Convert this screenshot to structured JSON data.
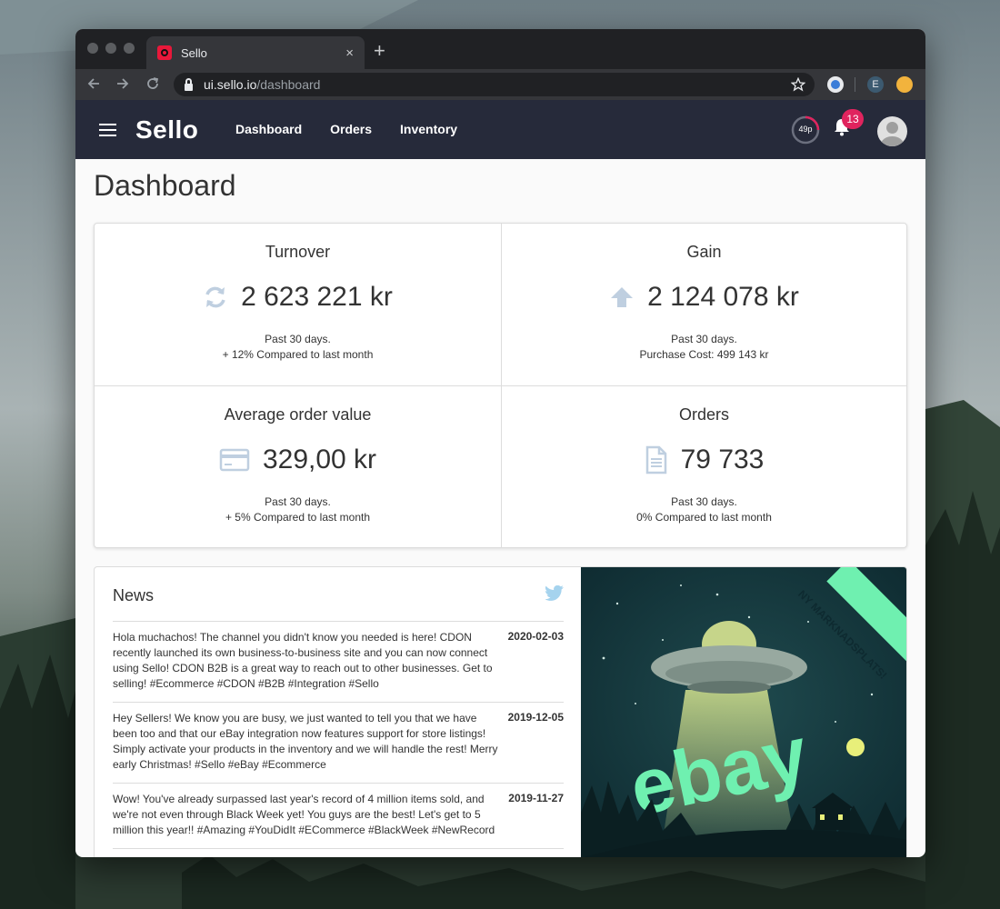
{
  "browser": {
    "tab_title": "Sello",
    "tab_close": "×",
    "new_tab": "+",
    "url_host": "ui.sello.io",
    "url_path": "/dashboard",
    "profile_initial": "E"
  },
  "app": {
    "logo": "Sello",
    "menu": [
      "Dashboard",
      "Orders",
      "Inventory"
    ],
    "quota_label": "49p",
    "notifications_count": "13"
  },
  "page": {
    "title": "Dashboard"
  },
  "stats": [
    {
      "title": "Turnover",
      "value": "2 623 221 kr",
      "icon": "refresh-icon",
      "sub1": "Past 30 days.",
      "sub2": "+ 12% Compared to last month"
    },
    {
      "title": "Gain",
      "value": "2 124 078 kr",
      "icon": "arrow-up-icon",
      "sub1": "Past 30 days.",
      "sub2": "Purchase Cost: 499 143 kr"
    },
    {
      "title": "Average order value",
      "value": "329,00 kr",
      "icon": "credit-card-icon",
      "sub1": "Past 30 days.",
      "sub2": "+ 5% Compared to last month"
    },
    {
      "title": "Orders",
      "value": "79 733",
      "icon": "document-icon",
      "sub1": "Past 30 days.",
      "sub2": "0% Compared to last month"
    }
  ],
  "news": {
    "title": "News",
    "items": [
      {
        "date": "2020-02-03",
        "text": "Hola muchachos! The channel you didn't know you needed is here! CDON recently launched its own business-to-business site and you can now connect using Sello! CDON B2B is a great way to reach out to other businesses. Get to selling! #Ecommerce #CDON #B2B #Integration #Sello"
      },
      {
        "date": "2019-12-05",
        "text": "Hey Sellers! We know you are busy, we just wanted to tell you that we have been too and that our eBay integration now features support for store listings! Simply activate your products in the inventory and we will handle the rest! Merry early Christmas! #Sello #eBay #Ecommerce"
      },
      {
        "date": "2019-11-27",
        "text": "Wow! You've already surpassed last year's record of 4 million items sold, and we're not even through Black Week yet! You guys are the best! Let's get to 5 million this year!! #Amazing #YouDidIt #ECommerce #BlackWeek #NewRecord"
      }
    ]
  },
  "promo": {
    "ribbon": "NY MARKNADSPLATS!",
    "brand": "ebay"
  },
  "colors": {
    "appbar": "#262a3a",
    "badge": "#e0245e",
    "icon": "#bfcfe0",
    "promo_bg": "#123238",
    "brand_green": "#6ff0b0"
  }
}
